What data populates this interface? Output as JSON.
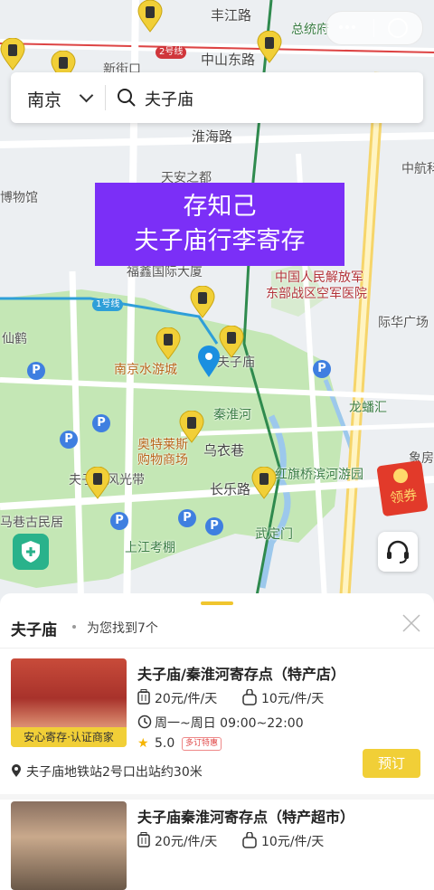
{
  "map": {
    "roads": [
      "丰江路",
      "中山东路",
      "淮海路",
      "长乐路",
      "乌衣巷",
      "秦淮河"
    ],
    "places": [
      "总统府",
      "新街口",
      "天安之都",
      "南京市博物馆",
      "福鑫国际大厦",
      "中国人民解放军",
      "东部战区空军医院",
      "南京水游城",
      "秦淮河",
      "奥特莱斯",
      "购物商场",
      "夫子庙",
      "夫子庙风光带",
      "龙蟠汇",
      "武定门",
      "象房",
      "中航科",
      "际华广场",
      "红旗桥滨河游园",
      "上江考棚",
      "马巷古民居",
      "仙鹤",
      "博物馆"
    ],
    "metro_line2": "2号线",
    "metro_line1": "1号线",
    "station": "新街口"
  },
  "search": {
    "city": "南京",
    "query": "夫子庙"
  },
  "banner": {
    "line1": "存知己",
    "line2": "夫子庙行李寄存"
  },
  "coupon": {
    "label": "领券"
  },
  "sheet": {
    "title": "夫子庙",
    "count_text": "为您找到7个"
  },
  "stores": [
    {
      "name": "夫子庙/秦淮河寄存点（特产店）",
      "price_large": "20元/件/天",
      "price_small": "10元/件/天",
      "hours": "周一~周日 09:00~22:00",
      "rating": "5.0",
      "tag": "多订特惠",
      "badge": "安心寄存·认证商家",
      "address": "夫子庙地铁站2号口出站约30米",
      "book": "预订"
    },
    {
      "name": "夫子庙秦淮河寄存点（特产超市）",
      "price_large": "20元/件/天",
      "price_small": "10元/件/天"
    }
  ]
}
